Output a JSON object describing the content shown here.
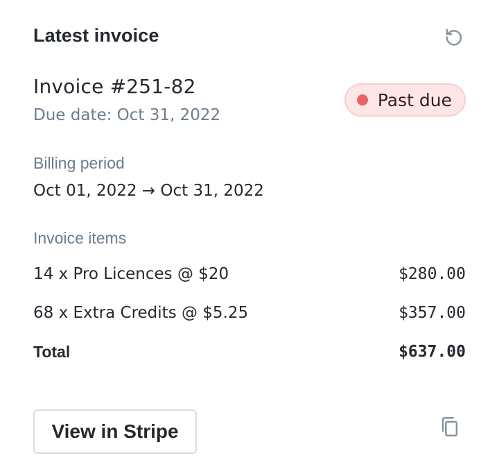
{
  "header": {
    "title": "Latest invoice",
    "refresh_icon": "refresh-icon"
  },
  "invoice": {
    "number": "Invoice #251-82",
    "due_date": "Due date: Oct 31, 2022",
    "status": {
      "label": "Past due",
      "color": "#ea6262",
      "background": "#fde6e6"
    }
  },
  "billing": {
    "label": "Billing period",
    "period": "Oct 01, 2022 → Oct 31, 2022"
  },
  "items": {
    "label": "Invoice items",
    "rows": [
      {
        "name": "14 x Pro Licences @ $20",
        "amount": "$280.00"
      },
      {
        "name": "68 x Extra Credits @ $5.25",
        "amount": "$357.00"
      }
    ],
    "total_label": "Total",
    "total_amount": "$637.00"
  },
  "actions": {
    "stripe_label": "View in Stripe",
    "copy_icon": "copy-icon"
  }
}
